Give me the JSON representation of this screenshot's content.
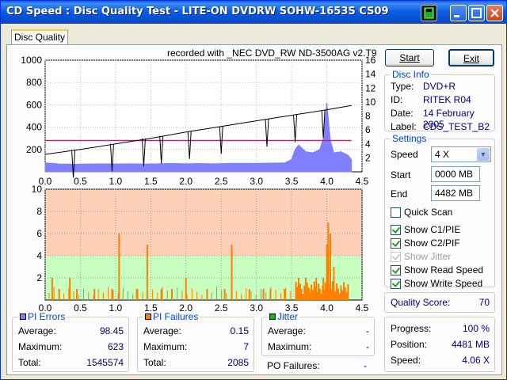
{
  "window": {
    "title": "CD Speed : Disc Quality Test - LITE-ON DVDRW SOHW-1653S CS09"
  },
  "tabs": [
    {
      "label": "Disc Quality"
    }
  ],
  "graph_header": "recorded with _NEC    DVD_RW ND-3500AG v2.T9",
  "buttons": {
    "start": "Start",
    "exit": "Exit"
  },
  "disc_info": {
    "title": "Disc Info",
    "type_label": "Type:",
    "type": "DVD+R",
    "id_label": "ID:",
    "id": "RITEK R04",
    "date_label": "Date:",
    "date": "14 February 2005",
    "label_label": "Label:",
    "label": "CDS_TEST_B2"
  },
  "settings": {
    "title": "Settings",
    "speed_label": "Speed",
    "speed": "4 X",
    "start_label": "Start",
    "start": "0000 MB",
    "end_label": "End",
    "end": "4482 MB",
    "quick_scan": "Quick Scan",
    "show_c1": "Show C1/PIE",
    "show_c2": "Show C2/PIF",
    "show_jitter": "Show Jitter",
    "show_read": "Show Read Speed",
    "show_write": "Show Write Speed",
    "checks": {
      "quick_scan": false,
      "show_c1": true,
      "show_c2": true,
      "show_jitter": true,
      "show_read": true,
      "show_write": true
    }
  },
  "quality": {
    "label": "Quality Score:",
    "value": "70"
  },
  "progress": {
    "progress_label": "Progress:",
    "progress": "100 %",
    "position_label": "Position:",
    "position": "4481 MB",
    "speed_label": "Speed:",
    "speed": "4.06 X"
  },
  "pi_errors": {
    "title": "PI Errors",
    "average_label": "Average:",
    "average": "98.45",
    "maximum_label": "Maximum:",
    "maximum": "623",
    "total_label": "Total:",
    "total": "1545574"
  },
  "pi_failures": {
    "title": "PI Failures",
    "average_label": "Average:",
    "average": "0.15",
    "maximum_label": "Maximum:",
    "maximum": "7",
    "total_label": "Total:",
    "total": "2085"
  },
  "jitter": {
    "title": "Jitter",
    "average_label": "Average:",
    "average": "-",
    "maximum_label": "Maximum:",
    "maximum": "-",
    "po_label": "PO Failures:",
    "po": "-"
  },
  "colors": {
    "pie": "#8080ff",
    "pif": "#ff8000",
    "jitter": "#00c000",
    "speed_line": "#000000",
    "limit_line": "#ff0080",
    "bg_red": "#ffd0b8",
    "bg_yellow": "#ffe8c8",
    "bg_green": "#c8ffc0"
  },
  "chart_data": [
    {
      "type": "area",
      "series": [
        {
          "x": [
            0.0,
            0.2,
            0.4,
            0.6,
            0.8,
            1.0,
            1.2,
            1.4,
            1.6,
            1.8,
            2.0,
            2.2,
            2.4,
            2.6,
            2.8,
            3.0,
            3.2,
            3.4,
            3.5,
            3.55,
            3.6,
            3.7,
            3.8,
            3.9,
            3.95,
            4.0,
            4.05,
            4.1,
            4.2,
            4.3,
            4.35
          ],
          "y": [
            80,
            70,
            68,
            70,
            72,
            70,
            72,
            70,
            72,
            75,
            72,
            75,
            72,
            75,
            75,
            75,
            78,
            80,
            110,
            200,
            240,
            180,
            170,
            200,
            300,
            620,
            280,
            170,
            180,
            150,
            110
          ]
        },
        {
          "x": [
            0.0,
            0.5,
            1.0,
            1.5,
            2.0,
            2.5,
            3.0,
            3.5,
            4.0,
            4.35
          ],
          "y": [
            2.5,
            3.2,
            4.0,
            4.8,
            5.7,
            6.5,
            7.3,
            8.1,
            8.9,
            9.5
          ]
        }
      ],
      "xlim": [
        0,
        4.5
      ],
      "ylim": [
        0,
        1000
      ],
      "y2lim": [
        0,
        16
      ],
      "y_ticks": [
        200,
        400,
        600,
        800,
        1000
      ],
      "y2_ticks": [
        2,
        4,
        6,
        8,
        10,
        12,
        14,
        16
      ],
      "x_ticks": [
        "0.0",
        "0.5",
        "1.0",
        "1.5",
        "2.0",
        "2.5",
        "3.0",
        "3.5",
        "4.0",
        "4.5"
      ],
      "limit_line": 280
    },
    {
      "type": "bar",
      "series": [
        {
          "x": [
            0.1,
            0.2,
            0.35,
            0.45,
            0.7,
            0.95,
            1.05,
            1.3,
            1.45,
            1.65,
            1.8,
            2.0,
            2.3,
            2.55,
            2.65,
            2.9,
            3.1,
            3.2,
            3.4,
            3.6,
            3.7,
            3.75,
            3.85,
            3.9,
            3.95,
            4.0,
            4.02,
            4.05,
            4.1,
            4.2,
            4.3
          ],
          "y": [
            2,
            1,
            2,
            1,
            1,
            1,
            6,
            1,
            5,
            1,
            1,
            2,
            1,
            1,
            5,
            1,
            1,
            1,
            1,
            2,
            2,
            1,
            2,
            1,
            2,
            5,
            7,
            6,
            3,
            1,
            1
          ]
        }
      ],
      "xlim": [
        0,
        4.5
      ],
      "ylim": [
        0,
        10
      ],
      "y_ticks": [
        2,
        4,
        6,
        8,
        10
      ],
      "x_ticks": [
        "0.0",
        "0.5",
        "1.0",
        "1.5",
        "2.0",
        "2.5",
        "3.0",
        "3.5",
        "4.0",
        "4.5"
      ]
    }
  ]
}
